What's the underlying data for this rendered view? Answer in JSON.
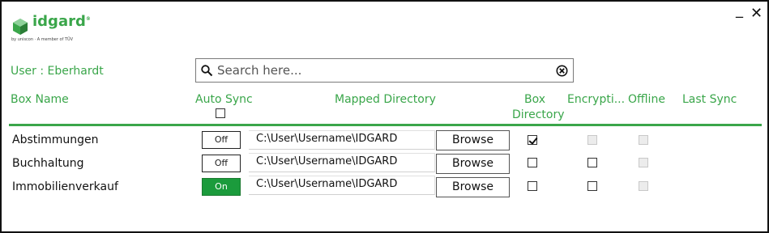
{
  "app": {
    "logo_text": "idgard",
    "logo_reg": "®",
    "logo_sub": "by uniscon · A member of TÜV"
  },
  "window": {
    "minimize_label": "_",
    "close_label": "✕"
  },
  "user_label": "User : Eberhardt",
  "search": {
    "placeholder": "Search here...",
    "value": ""
  },
  "columns": {
    "box_name": "Box Name",
    "auto_sync": "Auto Sync",
    "mapped_directory": "Mapped Directory",
    "box_directory_line1": "Box",
    "box_directory_line2": "Directory",
    "encryption": "Encrypti...",
    "offline": "Offline",
    "last_sync": "Last Sync"
  },
  "rows": [
    {
      "name": "Abstimmungen",
      "auto_sync": "Off",
      "path": "C:\\User\\Username\\IDGARD",
      "browse": "Browse",
      "box_directory": true,
      "encryption": false,
      "offline": false,
      "last_sync": ""
    },
    {
      "name": "Buchhaltung",
      "auto_sync": "Off",
      "path": "C:\\User\\Username\\IDGARD",
      "browse": "Browse",
      "box_directory": false,
      "encryption": false,
      "offline": false,
      "last_sync": ""
    },
    {
      "name": "Immobilienverkauf",
      "auto_sync": "On",
      "path": "C:\\User\\Username\\IDGARD",
      "browse": "Browse",
      "box_directory": false,
      "encryption": false,
      "offline": false,
      "last_sync": ""
    }
  ],
  "colors": {
    "accent": "#3aa64a",
    "toggle_on": "#1b9b3c"
  }
}
